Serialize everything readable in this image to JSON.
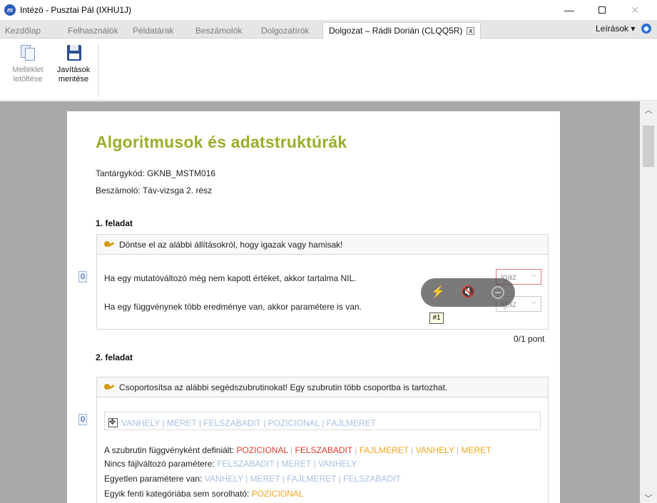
{
  "window": {
    "title": "Intézö - Pusztai Pál (IXHU1J)",
    "app_icon_letter": "m"
  },
  "tabs": [
    {
      "label": "Kezdőlap"
    },
    {
      "label": "Felhasználók"
    },
    {
      "label": "Példatárak"
    },
    {
      "label": "Beszámolók"
    },
    {
      "label": "Dolgozatírók"
    },
    {
      "label": "Dolgozat – Rádli Dorián (CLQQ5R)",
      "active": true
    }
  ],
  "tab_close": "x",
  "leirasok": "Leírások ▾",
  "toolbar": {
    "attachment_line1": "Melléklet",
    "attachment_line2": "letöltése",
    "save_line1": "Javítások",
    "save_line2": "mentése"
  },
  "document": {
    "title": "Algoritmusok és adatstruktúrák",
    "course_code": "Tantárgykód: GKNB_MSTM016",
    "report": "Beszámoló: Táv-vizsga 2. rész"
  },
  "task1": {
    "heading": "1. feladat",
    "instruction": "Döntse el az alábbi állításokról, hogy igazak vagy hamisak!",
    "score": "0",
    "statements": [
      {
        "text": "Ha egy mutatóváltozó még nem kapott értéket, akkor tartalma NIL.",
        "answer": "igaz"
      },
      {
        "text": "Ha egy függvénynek több eredménye van, akkor paramétere is van.",
        "answer": "igaz"
      }
    ],
    "points": "0/1 pont"
  },
  "task2": {
    "heading": "2. feladat",
    "instruction": "Csoportosítsa az alábbi segédszubrutinokat! Egy szubrutin több csoportba is tartozhat.",
    "score": "0",
    "pool": "VANHELY | MERET | FELSZABADIT | POZICIONAL | FAJLMERET",
    "groups": [
      {
        "label": "A szubrutin függvényként definiált: ",
        "items": [
          {
            "text": "POZICIONAL",
            "color": "red"
          },
          {
            "text": "FELSZABADIT",
            "color": "red"
          },
          {
            "text": "FAJLMERET",
            "color": "orange"
          },
          {
            "text": "VANHELY",
            "color": "orange"
          },
          {
            "text": "MERET",
            "color": "orange"
          }
        ]
      },
      {
        "label": "Nincs fájlváltozó paramétere: ",
        "items": [
          {
            "text": "FELSZABADIT",
            "color": "blue"
          },
          {
            "text": "MERET",
            "color": "blue"
          },
          {
            "text": "VANHELY",
            "color": "blue"
          }
        ]
      },
      {
        "label": "Egyetlen paramétere van: ",
        "items": [
          {
            "text": "VANHELY",
            "color": "blue"
          },
          {
            "text": "MERET",
            "color": "blue"
          },
          {
            "text": "FAJLMERET",
            "color": "blue"
          },
          {
            "text": "FELSZABADIT",
            "color": "blue"
          }
        ]
      },
      {
        "label": "Egyik fenti kategóriába sem sorolható: ",
        "items": [
          {
            "text": "POZICIONAL",
            "color": "orange"
          }
        ]
      }
    ]
  },
  "overlay_tooltip": "#1",
  "colors": {
    "title": "#9aae2a",
    "red": "#e23b2e",
    "orange": "#f2a41c",
    "blue": "#a7bfe0"
  }
}
